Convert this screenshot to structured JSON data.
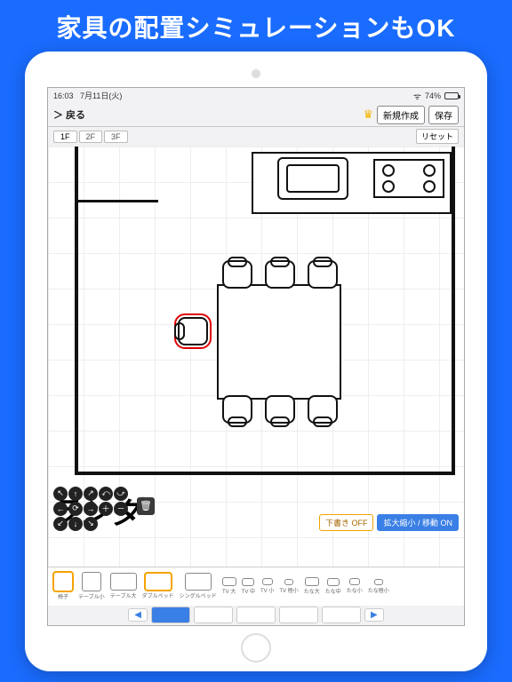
{
  "headline": "家具の配置シミュレーションもOK",
  "status": {
    "time": "16:03",
    "date": "7月11日(火)",
    "battery_pct": "74%"
  },
  "toolbar": {
    "back": "＞ 戻る",
    "new": "新規作成",
    "save": "保存"
  },
  "floors": {
    "f1": "1F",
    "f2": "2F",
    "f3": "3F",
    "reset": "リセット"
  },
  "label": {
    "balcony": "ランダ"
  },
  "pad": {
    "nw": "↖",
    "n": "↑",
    "ne": "↗",
    "w": "←",
    "c": "⟳",
    "e": "→",
    "sw": "↙",
    "s": "↓",
    "se": "↘",
    "rot1": "⤺",
    "rot2": "⤻",
    "z1": "＋",
    "z2": "－",
    "trash": "🗑"
  },
  "toggles": {
    "draft": "下書き OFF",
    "zoom": "拡大縮小 / 移動 ON"
  },
  "shelf": [
    {
      "label": "椅子"
    },
    {
      "label": "テーブル小"
    },
    {
      "label": "テーブル大"
    },
    {
      "label": "ダブルベッド"
    },
    {
      "label": "シングルベッド"
    },
    {
      "label": "TV 大"
    },
    {
      "label": "TV 中"
    },
    {
      "label": "TV 小"
    },
    {
      "label": "TV 極小"
    },
    {
      "label": "たな大"
    },
    {
      "label": "たな中"
    },
    {
      "label": "たな小"
    },
    {
      "label": "たな極小"
    }
  ],
  "pager": {
    "prev": "◀",
    "next": "▶"
  }
}
